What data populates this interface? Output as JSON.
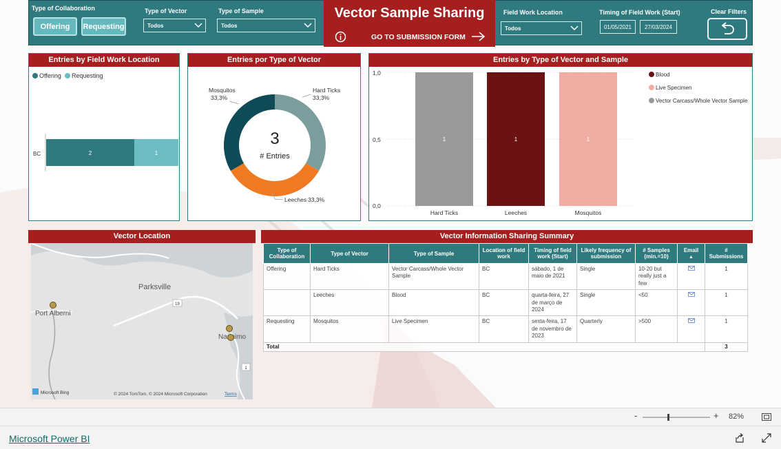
{
  "header": {
    "collab_label": "Type of Collaboration",
    "collab_buttons": [
      "Offering",
      "Requesting"
    ],
    "vector_label": "Type of Vector",
    "vector_value": "Todos",
    "sample_label": "Type of Sample",
    "sample_value": "Todos",
    "title": "Vector Sample Sharing",
    "goto_label": "GO TO SUBMISSION FORM",
    "location_label": "Field Work Location",
    "location_value": "Todos",
    "timing_label": "Timing of Field Work (Start)",
    "date_from": "01/05/2021",
    "date_to": "27/03/2024",
    "clear_label": "Clear Filters"
  },
  "panel_location": {
    "title": "Entries by Field Work Location",
    "legend": [
      {
        "name": "Offering",
        "color": "#2e7a7e"
      },
      {
        "name": "Requesting",
        "color": "#6bbdc1"
      }
    ],
    "category": "BC",
    "values": {
      "offering": "2",
      "requesting": "1"
    }
  },
  "panel_vector": {
    "title": "Entries por Type of Vector",
    "center_value": "3",
    "center_label": "# Entries",
    "slices": [
      {
        "name": "Mosquitos",
        "pct": "33,3%",
        "color": "#0f4b57"
      },
      {
        "name": "Hard Ticks",
        "pct": "33,3%",
        "color": "#7b9d9d"
      },
      {
        "name": "Leeches",
        "pct": "33,3%",
        "color": "#f07a21"
      }
    ]
  },
  "panel_sample": {
    "title": "Entries by Type of Vector and Sample",
    "legend": [
      {
        "name": "Blood",
        "color": "#6b1212"
      },
      {
        "name": "Live Specimen",
        "color": "#f1aca3"
      },
      {
        "name": "Vector Carcass/Whole Vector Sample",
        "color": "#9a9a9a"
      }
    ]
  },
  "chart_data": [
    {
      "type": "bar",
      "title": "Entries by Field Work Location",
      "orientation": "horizontal-stacked",
      "categories": [
        "BC"
      ],
      "series": [
        {
          "name": "Offering",
          "values": [
            2
          ]
        },
        {
          "name": "Requesting",
          "values": [
            1
          ]
        }
      ],
      "legend": "top-left"
    },
    {
      "type": "pie",
      "title": "Entries por Type of Vector",
      "categories": [
        "Mosquitos",
        "Hard Ticks",
        "Leeches"
      ],
      "values": [
        1,
        1,
        1
      ],
      "center_text": "3 # Entries"
    },
    {
      "type": "bar",
      "title": "Entries by Type of Vector and Sample",
      "categories": [
        "Hard Ticks",
        "Leeches",
        "Mosquitos"
      ],
      "series": [
        {
          "name": "Vector Carcass/Whole Vector Sample",
          "values": [
            1,
            0,
            0
          ]
        },
        {
          "name": "Blood",
          "values": [
            0,
            1,
            0
          ]
        },
        {
          "name": "Live Specimen",
          "values": [
            0,
            0,
            1
          ]
        }
      ],
      "yticks": [
        "0,0",
        "0,5",
        "1,0"
      ],
      "ylim": [
        0,
        1
      ],
      "legend": "right"
    }
  ],
  "map": {
    "title": "Vector Location",
    "places": [
      "Parksville",
      "Port Alberni",
      "Nanaimo"
    ],
    "road_labels": [
      "19",
      "1"
    ],
    "bing": "Microsoft Bing",
    "copyright": "© 2024 TomTom, © 2024 Microsoft Corporation",
    "terms": "Terms"
  },
  "summary": {
    "title": "Vector Information Sharing Summary",
    "columns": [
      "Type of Collaboration",
      "Type of Vector",
      "Type of Sample",
      "Location of field work",
      "Timing of field work (Start)",
      "Likely frequency of submission",
      "# Samples (min.=10)",
      "Email",
      "# Submissions"
    ],
    "rows": [
      {
        "collab": "Offering",
        "vector": "Hard Ticks",
        "sample": "Vector Carcass/Whole Vector Sample",
        "location": "BC",
        "timing": "sábado, 1 de maio de 2021",
        "frequency": "Single",
        "samples": "10-20 but really just a few",
        "submissions": "1"
      },
      {
        "collab": "",
        "vector": "Leeches",
        "sample": "Blood",
        "location": "BC",
        "timing": "quarta-feira, 27 de março de 2024",
        "frequency": "Single",
        "samples": "<50",
        "submissions": "1"
      },
      {
        "collab": "Requesting",
        "vector": "Mosquitos",
        "sample": "Live Specimen",
        "location": "BC",
        "timing": "sexta-feira, 17 de novembro de 2023",
        "frequency": "Quarterly",
        "samples": ">500",
        "submissions": "1"
      }
    ],
    "total_label": "Total",
    "total_value": "3"
  },
  "footer": {
    "zoom": "82%",
    "brand": "Microsoft Power BI"
  }
}
